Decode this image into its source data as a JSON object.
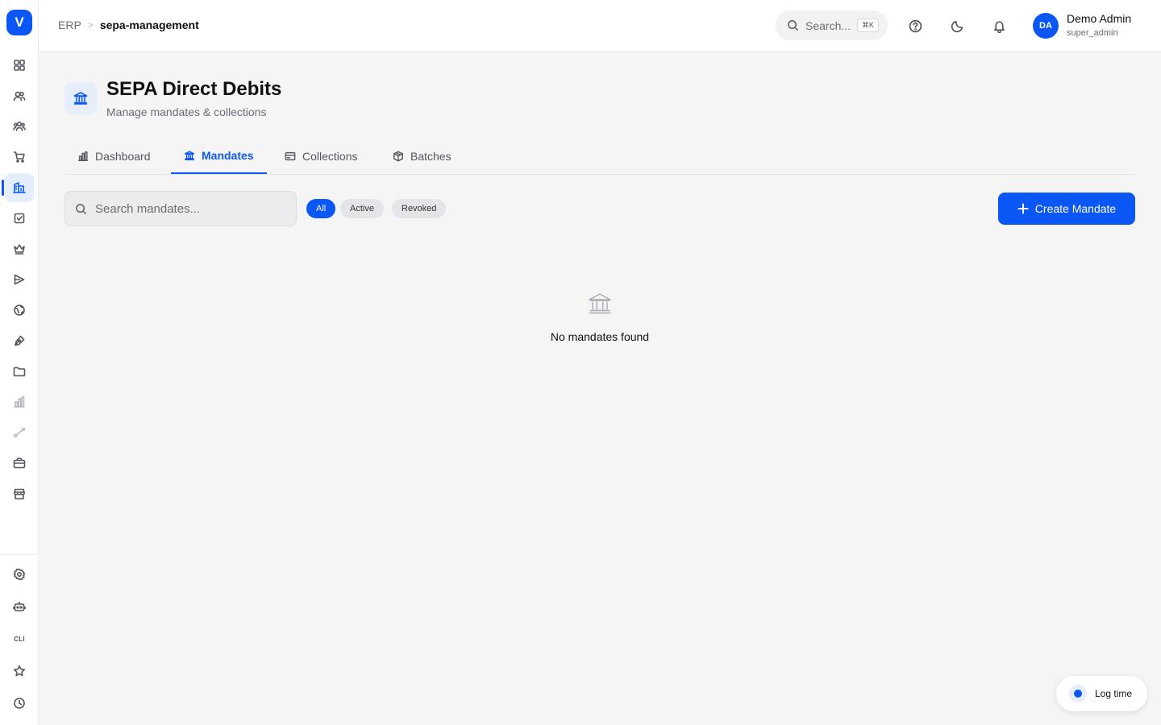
{
  "app": {
    "logo_letter": "V"
  },
  "breadcrumb": {
    "root": "ERP",
    "separator": ">",
    "current": "sepa-management"
  },
  "header": {
    "search_placeholder": "Search...",
    "search_shortcut": "⌘K",
    "user": {
      "initials": "DA",
      "name": "Demo Admin",
      "role": "super_admin"
    }
  },
  "page": {
    "title": "SEPA Direct Debits",
    "subtitle": "Manage mandates & collections"
  },
  "tabs": [
    {
      "label": "Dashboard",
      "icon": "bar-chart-icon",
      "active": false
    },
    {
      "label": "Mandates",
      "icon": "bank-icon",
      "active": true
    },
    {
      "label": "Collections",
      "icon": "credit-card-icon",
      "active": false
    },
    {
      "label": "Batches",
      "icon": "package-icon",
      "active": false
    }
  ],
  "toolbar": {
    "search_placeholder": "Search mandates...",
    "filters": [
      {
        "label": "All",
        "active": true
      },
      {
        "label": "Active",
        "active": false
      },
      {
        "label": "Revoked",
        "active": false
      }
    ],
    "create_label": "Create Mandate"
  },
  "empty_state": {
    "icon": "bank-icon",
    "message": "No mandates found"
  },
  "sidebar": {
    "items": [
      {
        "icon": "grid-icon"
      },
      {
        "icon": "users-icon"
      },
      {
        "icon": "team-icon"
      },
      {
        "icon": "cart-icon"
      },
      {
        "icon": "building-icon",
        "active": true
      },
      {
        "icon": "checkbox-icon"
      },
      {
        "icon": "crown-icon"
      },
      {
        "icon": "send-icon"
      },
      {
        "icon": "globe-icon"
      },
      {
        "icon": "pen-icon"
      },
      {
        "icon": "folder-icon"
      },
      {
        "icon": "chart-icon"
      },
      {
        "icon": "route-icon"
      },
      {
        "icon": "briefcase-icon"
      },
      {
        "icon": "store-icon"
      }
    ],
    "bottom": [
      {
        "icon": "settings-icon"
      },
      {
        "icon": "bot-icon"
      },
      {
        "label": "CLI"
      },
      {
        "icon": "star-icon"
      },
      {
        "icon": "clock-icon"
      }
    ]
  },
  "log_time": {
    "label": "Log time"
  },
  "colors": {
    "accent": "#0b57f5",
    "background": "#f5f5f6"
  }
}
